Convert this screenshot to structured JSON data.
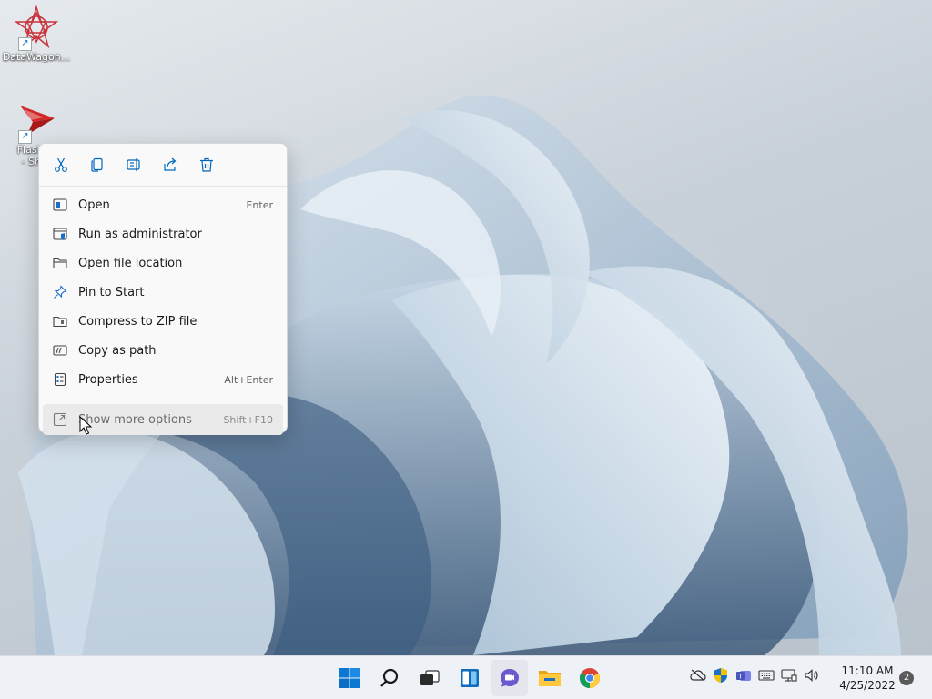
{
  "desktop": {
    "icons": [
      {
        "label": "DataWagon..."
      },
      {
        "label": "Flashpo\n- Shor"
      }
    ]
  },
  "context_menu": {
    "quick_actions": [
      {
        "icon": "cut-icon",
        "name": "Cut"
      },
      {
        "icon": "copy-icon",
        "name": "Copy"
      },
      {
        "icon": "rename-icon",
        "name": "Rename"
      },
      {
        "icon": "share-icon",
        "name": "Share"
      },
      {
        "icon": "delete-icon",
        "name": "Delete"
      }
    ],
    "items": [
      {
        "label": "Open",
        "shortcut": "Enter",
        "icon": "open-icon"
      },
      {
        "label": "Run as administrator",
        "shortcut": "",
        "icon": "shield-icon"
      },
      {
        "label": "Open file location",
        "shortcut": "",
        "icon": "folder-icon"
      },
      {
        "label": "Pin to Start",
        "shortcut": "",
        "icon": "pin-icon"
      },
      {
        "label": "Compress to ZIP file",
        "shortcut": "",
        "icon": "zip-icon"
      },
      {
        "label": "Copy as path",
        "shortcut": "",
        "icon": "path-icon"
      },
      {
        "label": "Properties",
        "shortcut": "Alt+Enter",
        "icon": "properties-icon"
      }
    ],
    "more": {
      "label": "Show more options",
      "shortcut": "Shift+F10",
      "icon": "more-options-icon"
    }
  },
  "taskbar": {
    "apps": [
      {
        "icon": "start-icon"
      },
      {
        "icon": "search-icon"
      },
      {
        "icon": "task-view-icon"
      },
      {
        "icon": "widgets-icon"
      },
      {
        "icon": "chat-icon"
      },
      {
        "icon": "file-explorer-icon"
      },
      {
        "icon": "chrome-icon"
      }
    ],
    "tray": [
      {
        "icon": "onedrive-icon"
      },
      {
        "icon": "security-icon"
      },
      {
        "icon": "teams-icon"
      },
      {
        "icon": "keyboard-icon"
      },
      {
        "icon": "network-icon"
      },
      {
        "icon": "volume-icon"
      }
    ],
    "clock": {
      "time": "11:10 AM",
      "date": "4/25/2022"
    },
    "notification_count": "2"
  },
  "colors": {
    "accent": "#0067c0",
    "menu_bg": "#f9f9f9",
    "taskbar_bg": "#eef1f6"
  }
}
